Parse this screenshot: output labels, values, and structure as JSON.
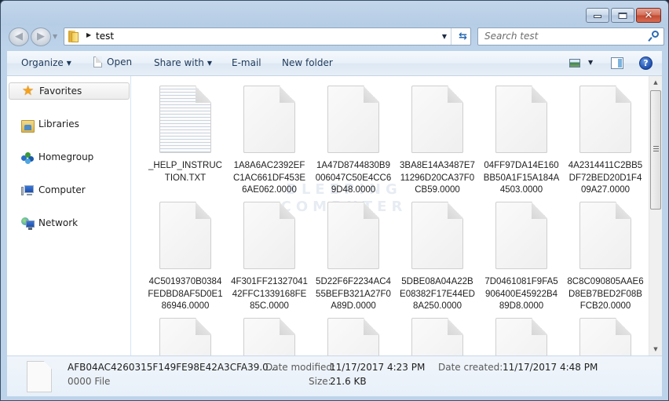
{
  "window": {
    "caption_buttons": {
      "minimize_icon": "minimize-icon",
      "maximize_icon": "maximize-icon",
      "close_icon": "close-icon",
      "close_glyph": "✕"
    }
  },
  "navbar": {
    "back_glyph": "◀",
    "forward_glyph": "▶",
    "breadcrumb": [
      "test"
    ],
    "breadcrumb_separator": "▶",
    "dropdown_glyph": "▼",
    "refresh_glyph": "⇆",
    "search": {
      "placeholder": "Search test",
      "value": ""
    }
  },
  "commandbar": {
    "organize": "Organize",
    "open": "Open",
    "share_with": "Share with",
    "email": "E-mail",
    "new_folder": "New folder",
    "drop_glyph": "▼",
    "help_glyph": "?"
  },
  "sidebar": {
    "items": [
      {
        "label": "Favorites",
        "icon": "star-icon",
        "selected": true
      },
      {
        "label": "Libraries",
        "icon": "libraries-icon",
        "selected": false
      },
      {
        "label": "Homegroup",
        "icon": "homegroup-icon",
        "selected": false
      },
      {
        "label": "Computer",
        "icon": "computer-icon",
        "selected": false
      },
      {
        "label": "Network",
        "icon": "network-icon",
        "selected": false
      }
    ],
    "star_glyph": "★"
  },
  "files": {
    "items": [
      {
        "name": "_HELP_INSTRUCTION.TXT",
        "type": "text"
      },
      {
        "name": "1A8A6AC2392EFC1AC661DF453E6AE062.0000",
        "type": "generic"
      },
      {
        "name": "1A47D8744830B9006047C50E4CC69D48.0000",
        "type": "generic"
      },
      {
        "name": "3BA8E14A3487E711296D20CA37F0CB59.0000",
        "type": "generic"
      },
      {
        "name": "04FF97DA14E160BB50A1F15A184A4503.0000",
        "type": "generic"
      },
      {
        "name": "4A2314411C2BB5DF72BED20D1F409A27.0000",
        "type": "generic"
      },
      {
        "name": "4C5019370B0384FEDBD8AF5D0E186946.0000",
        "type": "generic"
      },
      {
        "name": "4F301FF2132704142FFC1339168FE85C.0000",
        "type": "generic"
      },
      {
        "name": "5D22F6F2234AC455BEFB321A27F0A89D.0000",
        "type": "generic"
      },
      {
        "name": "5DBE08A04A22BE08382F17E44ED8A250.0000",
        "type": "generic"
      },
      {
        "name": "7D0461081F9FA5906400E45922B489D8.0000",
        "type": "generic"
      },
      {
        "name": "8C8C090805AAE6D8EB7BED2F08BFCB20.0000",
        "type": "generic"
      },
      {
        "name": "",
        "type": "generic"
      },
      {
        "name": "",
        "type": "generic"
      },
      {
        "name": "",
        "type": "generic"
      },
      {
        "name": "",
        "type": "generic"
      },
      {
        "name": "",
        "type": "generic"
      },
      {
        "name": "",
        "type": "generic"
      }
    ],
    "watermark": [
      "BLEEPING",
      "COMPUTER"
    ]
  },
  "scrollbar": {
    "up_glyph": "▲",
    "down_glyph": "▼",
    "position_fraction": 0.0,
    "visible_fraction": 0.45
  },
  "details": {
    "name": "AFB04AC4260315F149FE98E42A3CFA39.0...",
    "type": "0000 File",
    "date_modified_label": "Date modified:",
    "date_modified": "11/17/2017 4:23 PM",
    "size_label": "Size:",
    "size": "21.6 KB",
    "date_created_label": "Date created:",
    "date_created": "11/17/2017 4:48 PM"
  }
}
